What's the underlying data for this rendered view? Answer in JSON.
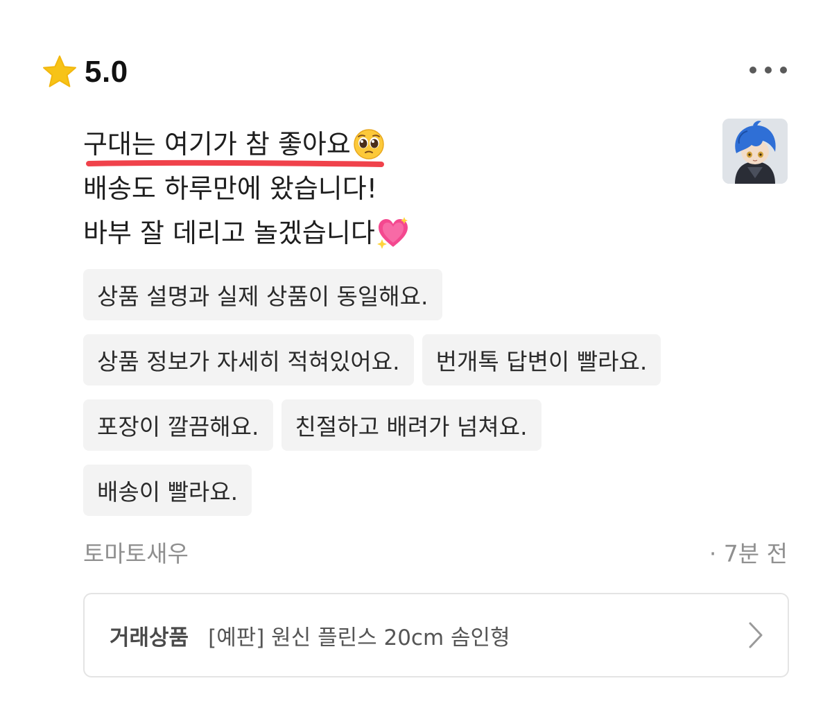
{
  "rating": {
    "value": "5.0",
    "star_icon": "star-icon",
    "star_color": "#F7C317"
  },
  "more_menu": {
    "icon": "more-horizontal-icon"
  },
  "review": {
    "lines": [
      "구대는 여기가 참 좋아요",
      "배송도 하루만에 왔습니다!",
      "바부 잘 데리고 놀겠습니다"
    ],
    "emojis": [
      "pleading-face-emoji",
      "sparkling-heart-emoji"
    ],
    "highlight_color": "#F0424B"
  },
  "avatar": {
    "icon": "user-avatar-figure"
  },
  "tags": [
    [
      "상품 설명과 실제 상품이 동일해요."
    ],
    [
      "상품 정보가 자세히 적혀있어요.",
      "번개톡 답변이 빨라요."
    ],
    [
      "포장이 깔끔해요.",
      "친절하고 배려가 넘쳐요."
    ],
    [
      "배송이 빨라요."
    ]
  ],
  "meta": {
    "author": "토마토새우",
    "time": "· 7분 전"
  },
  "product": {
    "label": "거래상품",
    "name": "[예판] 원신 플린스 20cm 솜인형",
    "chevron_icon": "chevron-right-icon"
  }
}
